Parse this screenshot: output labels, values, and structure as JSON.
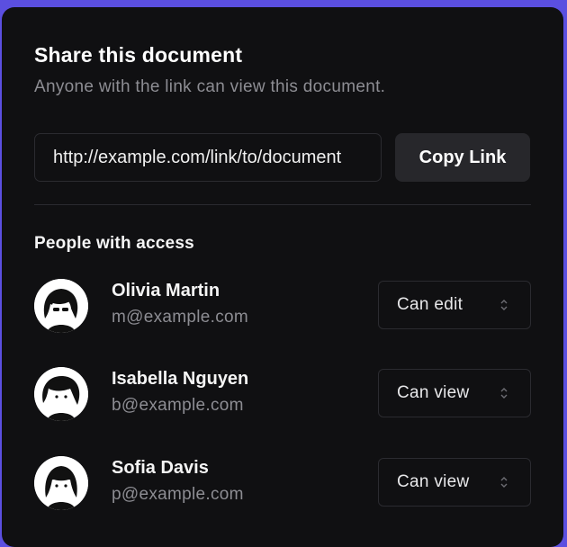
{
  "dialog": {
    "title": "Share this document",
    "subtitle": "Anyone with the link can view this document.",
    "link_value": "http://example.com/link/to/document",
    "copy_button_label": "Copy Link"
  },
  "people_section": {
    "heading": "People with access",
    "people": [
      {
        "name": "Olivia Martin",
        "email": "m@example.com",
        "role": "Can edit"
      },
      {
        "name": "Isabella Nguyen",
        "email": "b@example.com",
        "role": "Can view"
      },
      {
        "name": "Sofia Davis",
        "email": "p@example.com",
        "role": "Can view"
      }
    ]
  },
  "colors": {
    "backdrop": "#5b4fe0",
    "card": "#101012",
    "muted_text": "#8d8d93",
    "button_bg": "#27272b"
  }
}
